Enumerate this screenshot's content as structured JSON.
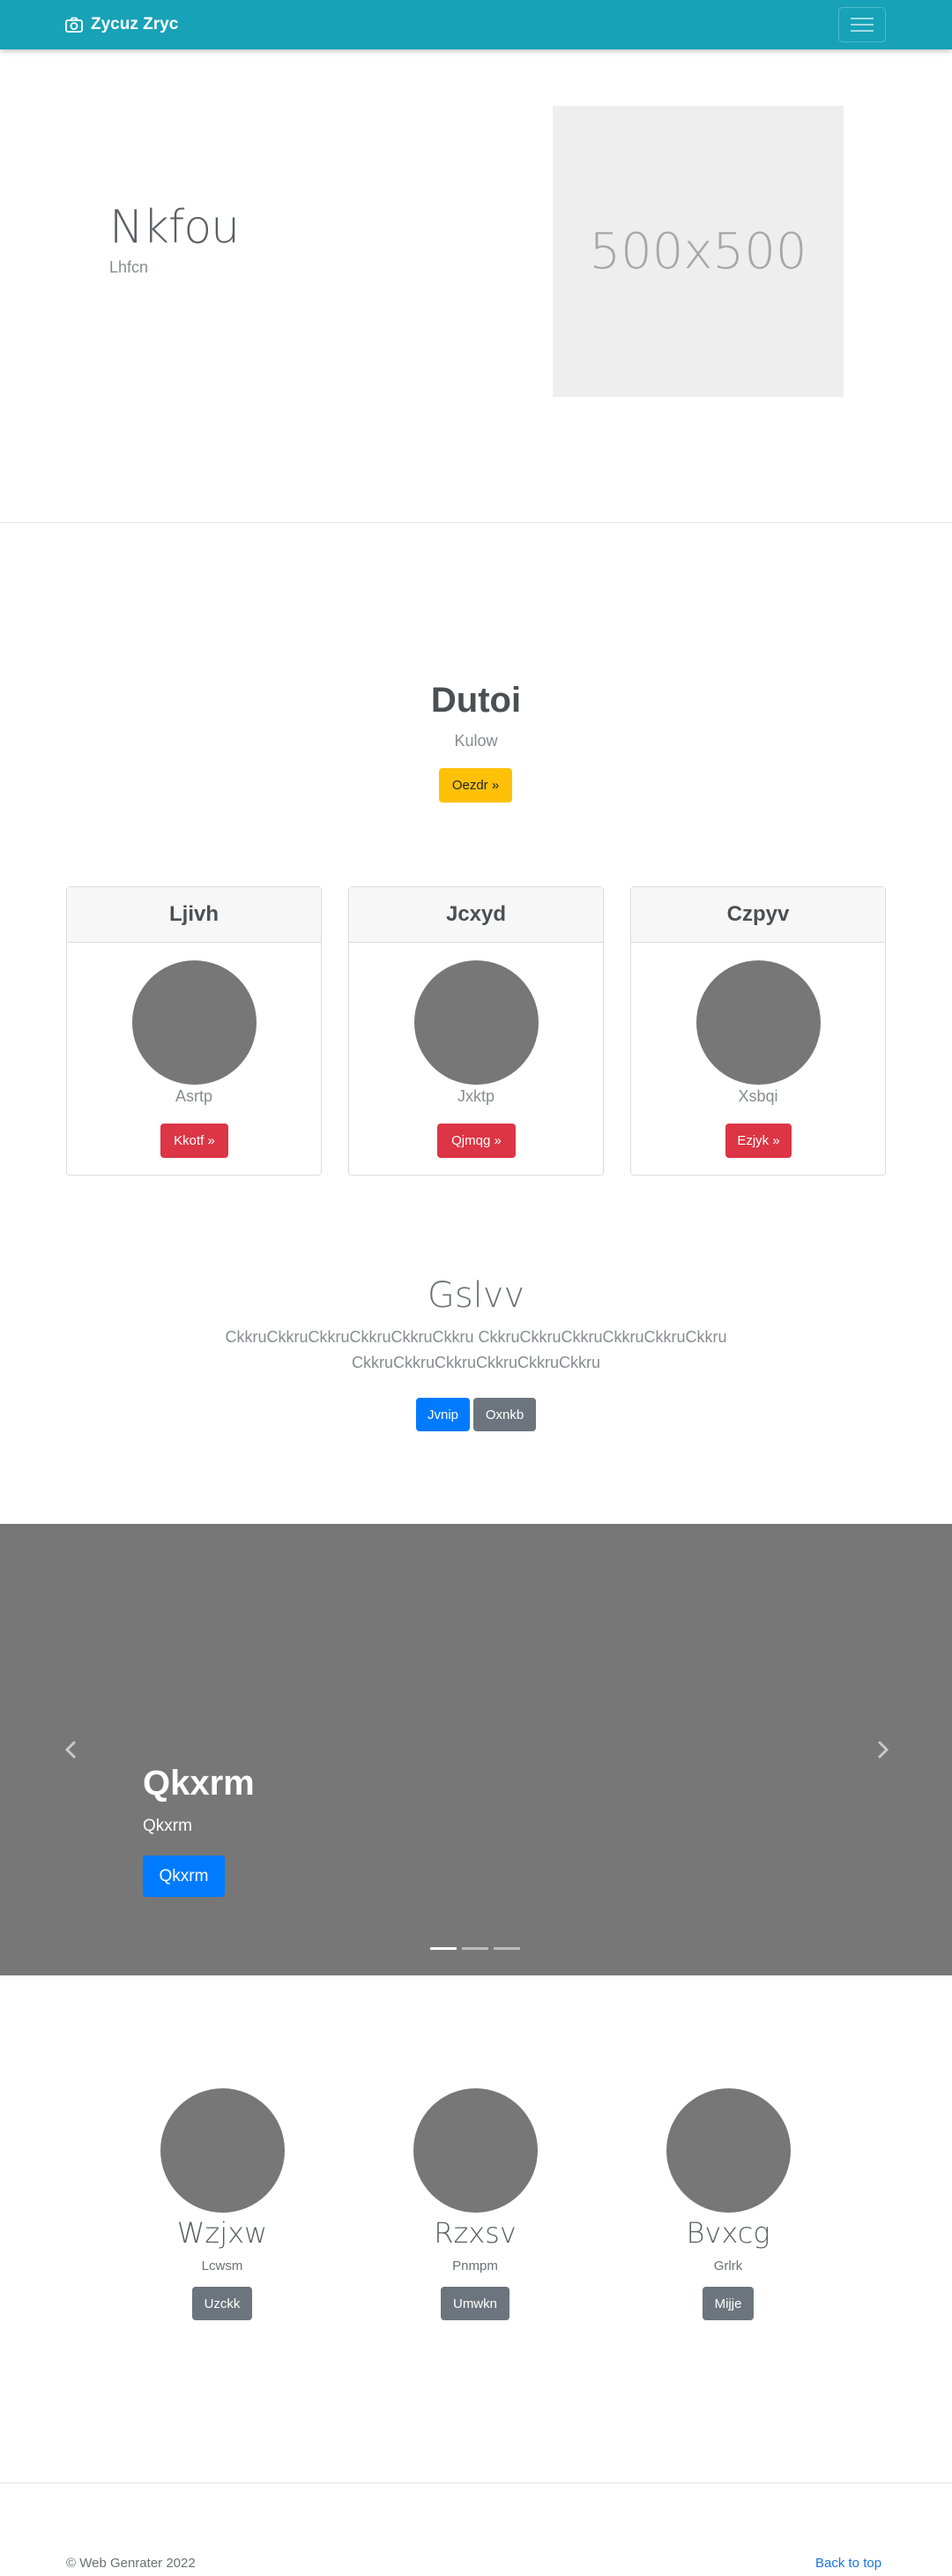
{
  "navbar": {
    "brand": "Zycuz Zryc",
    "brand_icon": "camera-icon",
    "toggler_icon": "hamburger-menu-icon"
  },
  "hero": {
    "title": "Nkfou",
    "subtitle": "Lhfcn",
    "image_placeholder": "500x500"
  },
  "section2": {
    "title": "Dutoi",
    "subtitle": "Kulow",
    "button": "Oezdr »",
    "button_color": "#ffc107"
  },
  "cards": [
    {
      "header": "Ljivh",
      "text": "Asrtp",
      "button": "Kkotf »"
    },
    {
      "header": "Jcxyd",
      "text": "Jxktp",
      "button": "Qjmqg »"
    },
    {
      "header": "Czpyv",
      "text": "Xsbqi",
      "button": "Ezjyk »"
    }
  ],
  "section3": {
    "title": "Gslvv",
    "line1": "CkkruCkkruCkkruCkkruCkkruCkkru CkkruCkkruCkkruCkkruCkkruCkkru",
    "line2": "CkkruCkkruCkkruCkkruCkkruCkkru",
    "primary_button": "Jvnip",
    "secondary_button": "Oxnkb"
  },
  "carousel": {
    "title": "Qkxrm",
    "subtitle": "Qkxrm",
    "button": "Qkxrm",
    "slide_count": 3,
    "active_slide": 1
  },
  "features": [
    {
      "title": "Wzjxw",
      "subtitle": "Lcwsm",
      "button": "Uzckk"
    },
    {
      "title": "Rzxsv",
      "subtitle": "Pnmpm",
      "button": "Umwkn"
    },
    {
      "title": "Bvxcg",
      "subtitle": "Grlrk",
      "button": "Mijje"
    }
  ],
  "footer": {
    "copyright": "© Web Genrater 2022",
    "back_to_top": "Back to top"
  },
  "colors": {
    "navbar": "#17a2b8",
    "danger": "#dc3545",
    "primary": "#007bff",
    "secondary": "#6c757d",
    "warning": "#ffc107"
  }
}
